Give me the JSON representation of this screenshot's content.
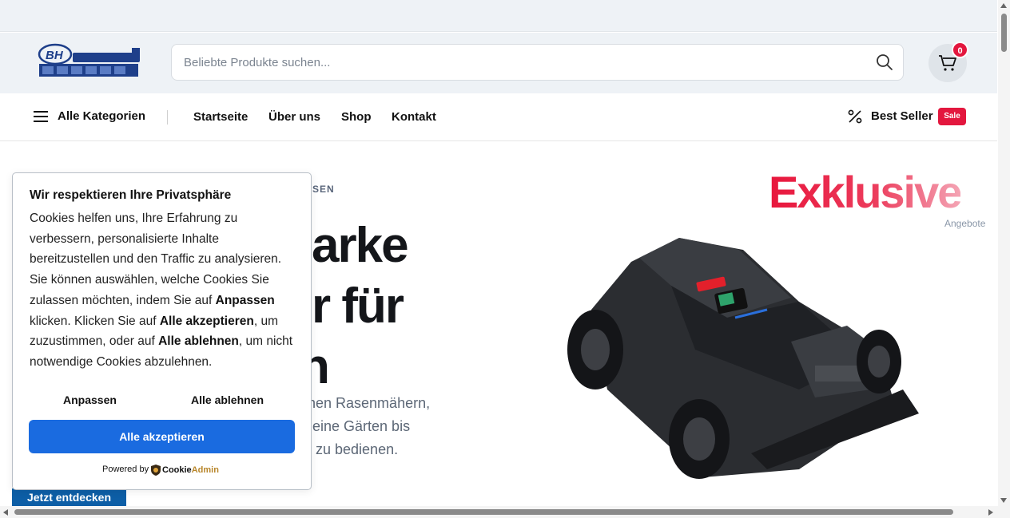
{
  "header": {
    "logo_alt": "BERNHARD HELLER",
    "search_placeholder": "Beliebte Produkte suchen...",
    "cart_count": "0"
  },
  "nav": {
    "categories_label": "Alle Kategorien",
    "links": [
      "Startseite",
      "Über uns",
      "Shop",
      "Kontakt"
    ],
    "best_seller_label": "Best Seller",
    "sale_badge": "Sale"
  },
  "hero": {
    "eyebrow_visible": "REISEN",
    "title_lines": [
      "arke",
      "r für",
      "n"
    ],
    "desc_lines": [
      "rnen Rasenmähern,",
      "kleine Gärten bis",
      "zu bedienen."
    ],
    "cta_label": "Jetzt entdecken",
    "promo_title": "Exklusive",
    "promo_subtitle": "Angebote"
  },
  "cookie": {
    "title": "Wir respektieren Ihre Privatsphäre",
    "text_1": "Cookies helfen uns, Ihre Erfahrung zu verbessern, personalisierte Inhalte bereitzustellen und den Traffic zu analysieren. Sie können auswählen, welche Cookies Sie zulassen möchten, indem Sie auf ",
    "text_b1": "Anpassen",
    "text_2": " klicken. Klicken Sie auf ",
    "text_b2": "Alle akzeptieren",
    "text_3": ", um zuzustimmen, oder auf ",
    "text_b3": "Alle ablehnen",
    "text_4": ", um nicht notwendige Cookies abzulehnen.",
    "customize_label": "Anpassen",
    "reject_label": "Alle ablehnen",
    "accept_label": "Alle akzeptieren",
    "powered_by": "Powered by",
    "brand_1": "Cookie",
    "brand_2": "Admin"
  },
  "colors": {
    "accent_red": "#e3173e",
    "accept_blue": "#1a6be0",
    "cta_blue": "#0d5ea6"
  }
}
